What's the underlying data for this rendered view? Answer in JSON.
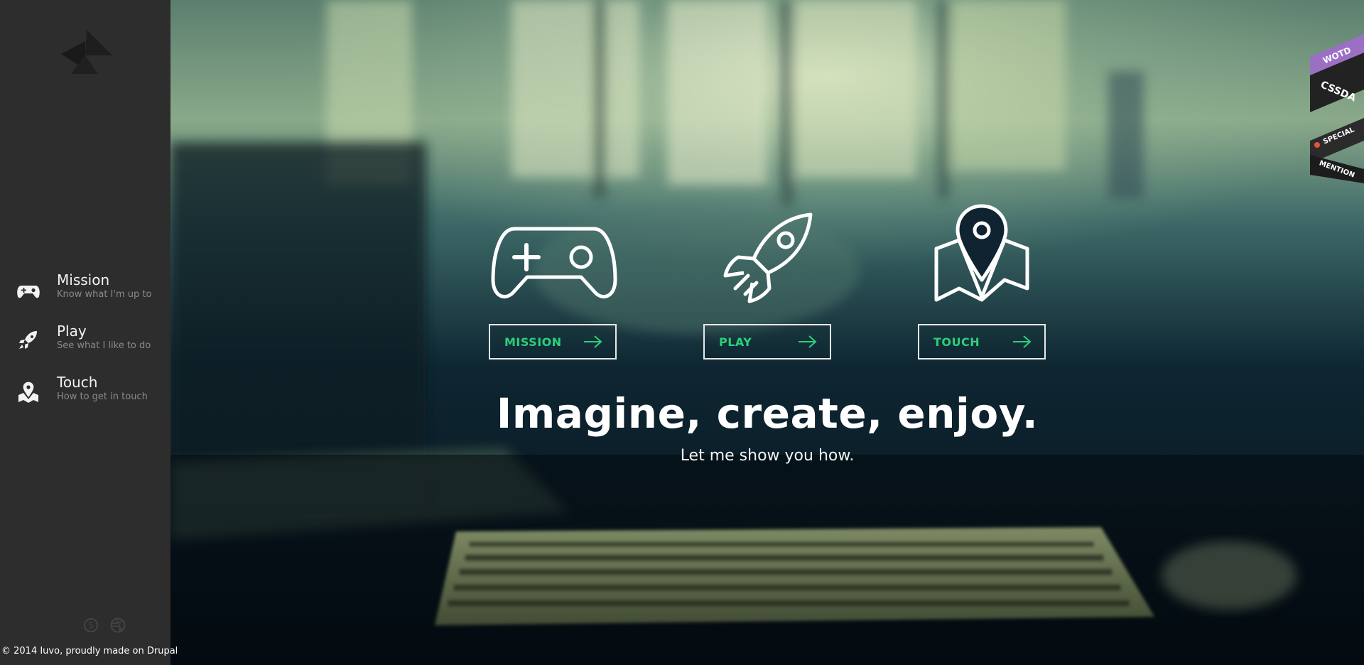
{
  "sidebar": {
    "nav": [
      {
        "title": "Mission",
        "subtitle": "Know what I'm up to",
        "icon": "gamepad-icon"
      },
      {
        "title": "Play",
        "subtitle": "See what I like to do",
        "icon": "rocket-icon"
      },
      {
        "title": "Touch",
        "subtitle": "How to get in touch",
        "icon": "map-pin-icon"
      }
    ],
    "social": [
      "skype-icon",
      "dribbble-icon"
    ],
    "footer": "© 2014 Iuvo, proudly made on Drupal"
  },
  "hero": {
    "buttons": [
      {
        "label": "MISSION",
        "icon": "gamepad-icon"
      },
      {
        "label": "PLAY",
        "icon": "rocket-icon"
      },
      {
        "label": "TOUCH",
        "icon": "map-pin-icon"
      }
    ],
    "headline": "Imagine, create, enjoy.",
    "subline": "Let me show you how."
  },
  "badges": {
    "wotd": "WOTD",
    "cssda": "CSSDA",
    "special": "SPECIAL",
    "mention": "MENTION"
  },
  "colors": {
    "sidebar_bg": "#2d2d2d",
    "accent_green": "#2bd17c",
    "badge_purple": "#9b6fc4"
  }
}
